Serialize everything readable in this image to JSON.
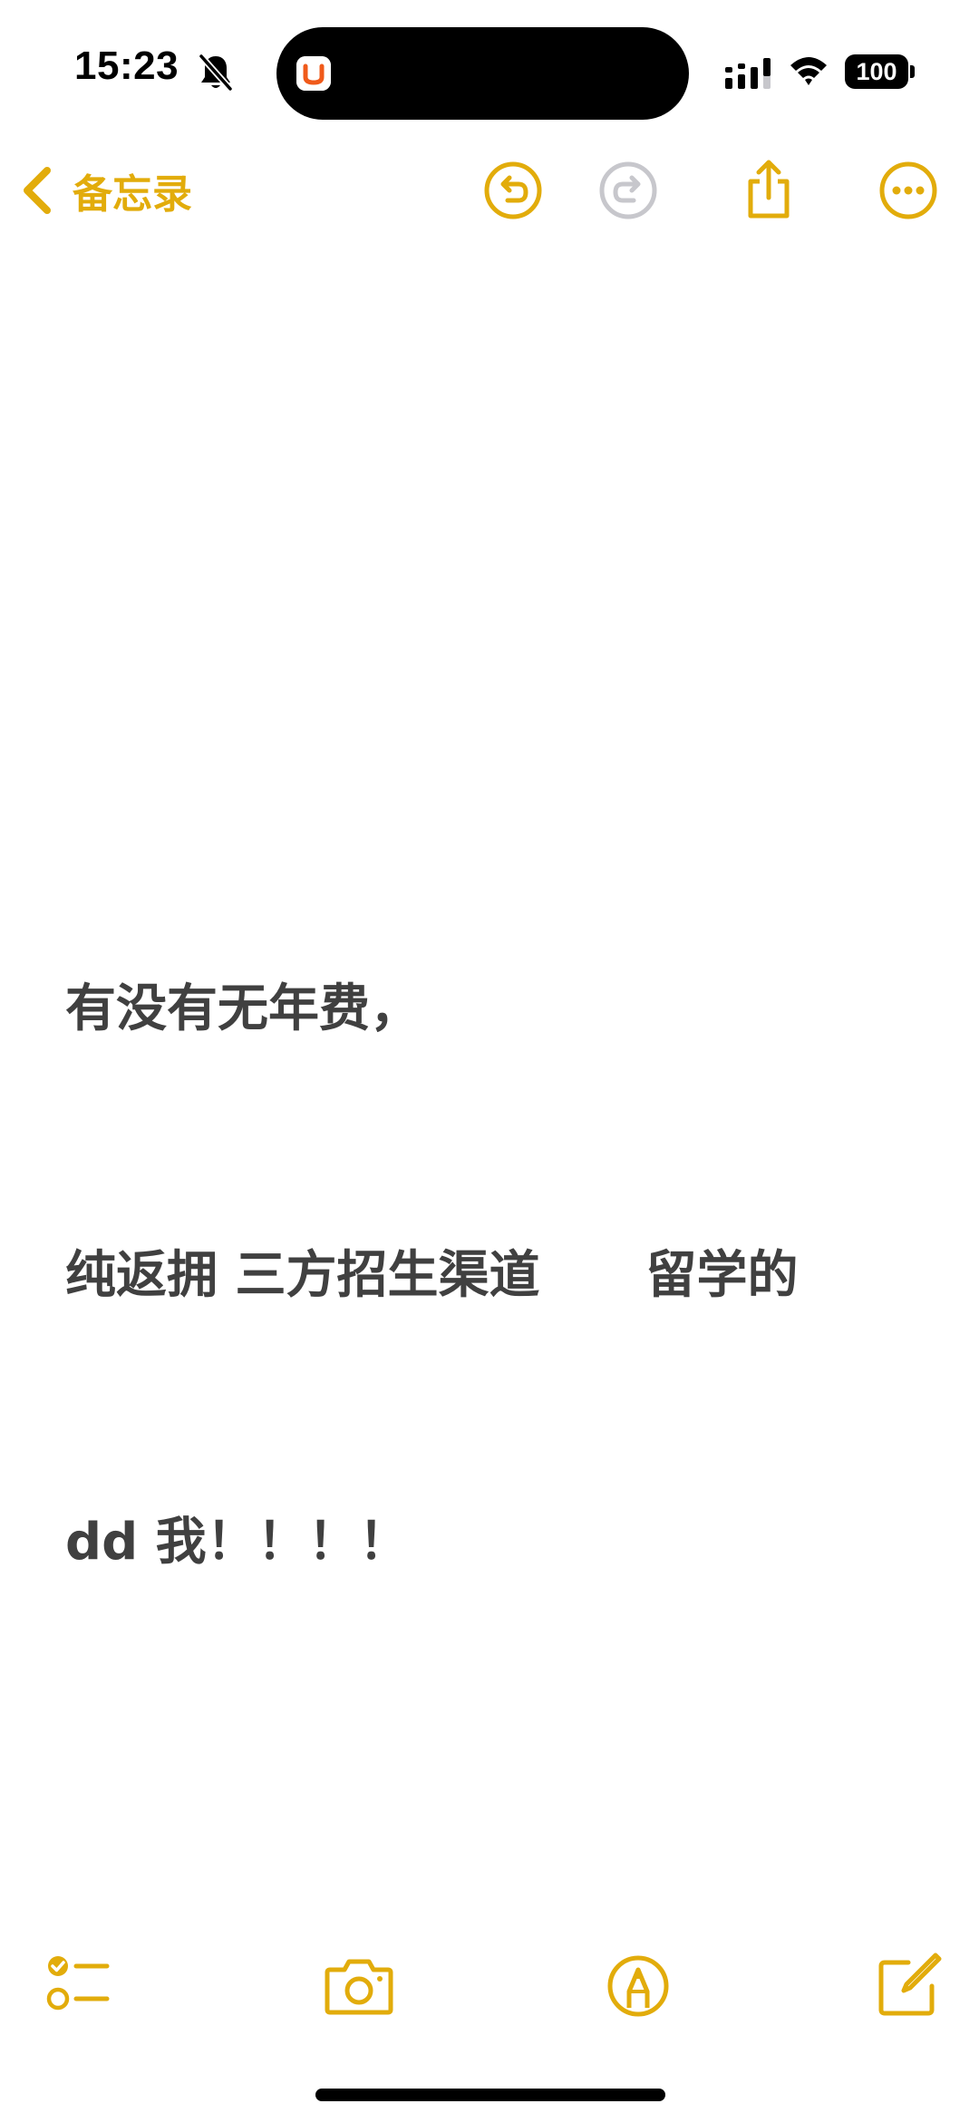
{
  "status_bar": {
    "time": "15:23",
    "battery_level": "100",
    "icons": [
      "bell-slash-icon",
      "cellular-signal-icon",
      "wifi-icon",
      "battery-icon"
    ],
    "island_app_icon": "didi-app-icon"
  },
  "nav": {
    "back_label": "备忘录",
    "icons": [
      "chevron-left-icon",
      "undo-icon",
      "redo-icon",
      "share-icon",
      "more-icon"
    ]
  },
  "note": {
    "lines": [
      "有没有无年费，",
      "纯返拥 三方招生渠道      留学的",
      "dd 我！！！！"
    ]
  },
  "toolbar": {
    "icons": [
      "checklist-icon",
      "camera-icon",
      "markup-icon",
      "compose-icon"
    ]
  },
  "colors": {
    "accent": "#E2AC0B",
    "disabled": "#C7C7CC",
    "text": "#404040",
    "background": "#FFFFFF"
  }
}
